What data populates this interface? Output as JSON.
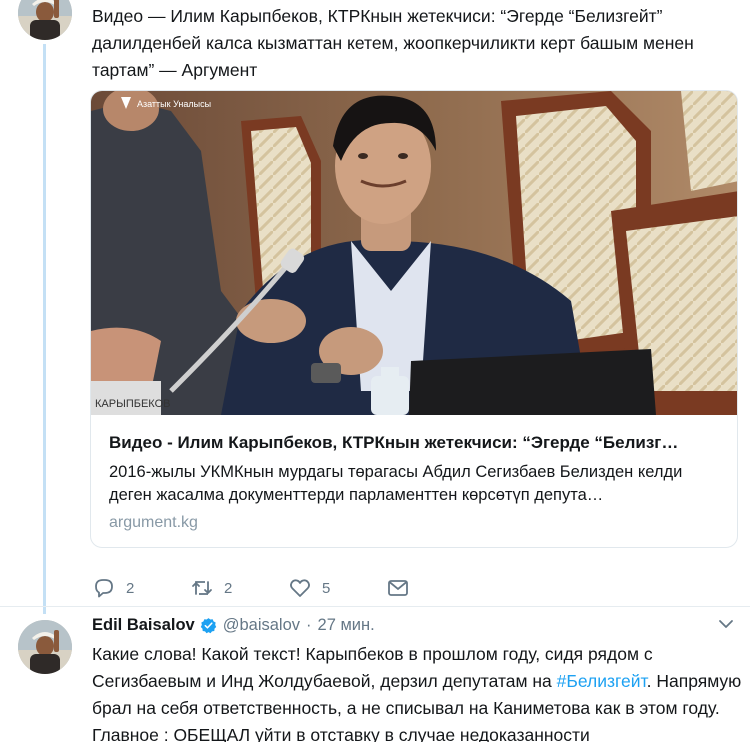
{
  "colors": {
    "accent": "#1da1f2",
    "thread_line": "#c4e0f5",
    "secondary_text": "#657786"
  },
  "tweet1": {
    "text": "Видео — Илим Карыпбеков, КТРКнын жетекчиси: “Эгерде “Белизгейт” далилденбей калса кызматтан кетем, жоопкерчиликти керт башым менен тартам” — Аргумент",
    "card": {
      "watermark": "Азаттык Уналысы",
      "nameplate": "КАРЫПБЕКОВ",
      "title": "Видео - Илим Карыпбеков, КТРКнын жетекчиси: “Эгерде “Белизг…",
      "description": "2016-жылы УКМКнын мурдагы төрагасы Абдил Сегизбаев Белизден келди деген жасалма документтерди парламенттен көрсөтүп депута…",
      "domain": "argument.kg"
    },
    "actions": {
      "reply": {
        "icon": "reply-icon",
        "count": "2"
      },
      "retweet": {
        "icon": "retweet-icon",
        "count": "2"
      },
      "like": {
        "icon": "heart-icon",
        "count": "5"
      },
      "dm": {
        "icon": "envelope-icon"
      }
    }
  },
  "tweet2": {
    "author_name": "Edil Baisalov",
    "handle": "@baisalov",
    "separator": "·",
    "time": "27 мин.",
    "text_before_hashtag": "Какие слова! Какой текст! Карыпбеков в прошлом году, сидя рядом с Сегизбаевым и Инд Жолдубаевой, дерзил депутатам на ",
    "hashtag": "#Белизгейт",
    "text_after_hashtag": ". Напрямую брал на себя ответственность, а не списывал на Каниметова как в этом году. Главное : ОБЕЩАЛ уйти в отставку в случае недоказанности"
  }
}
